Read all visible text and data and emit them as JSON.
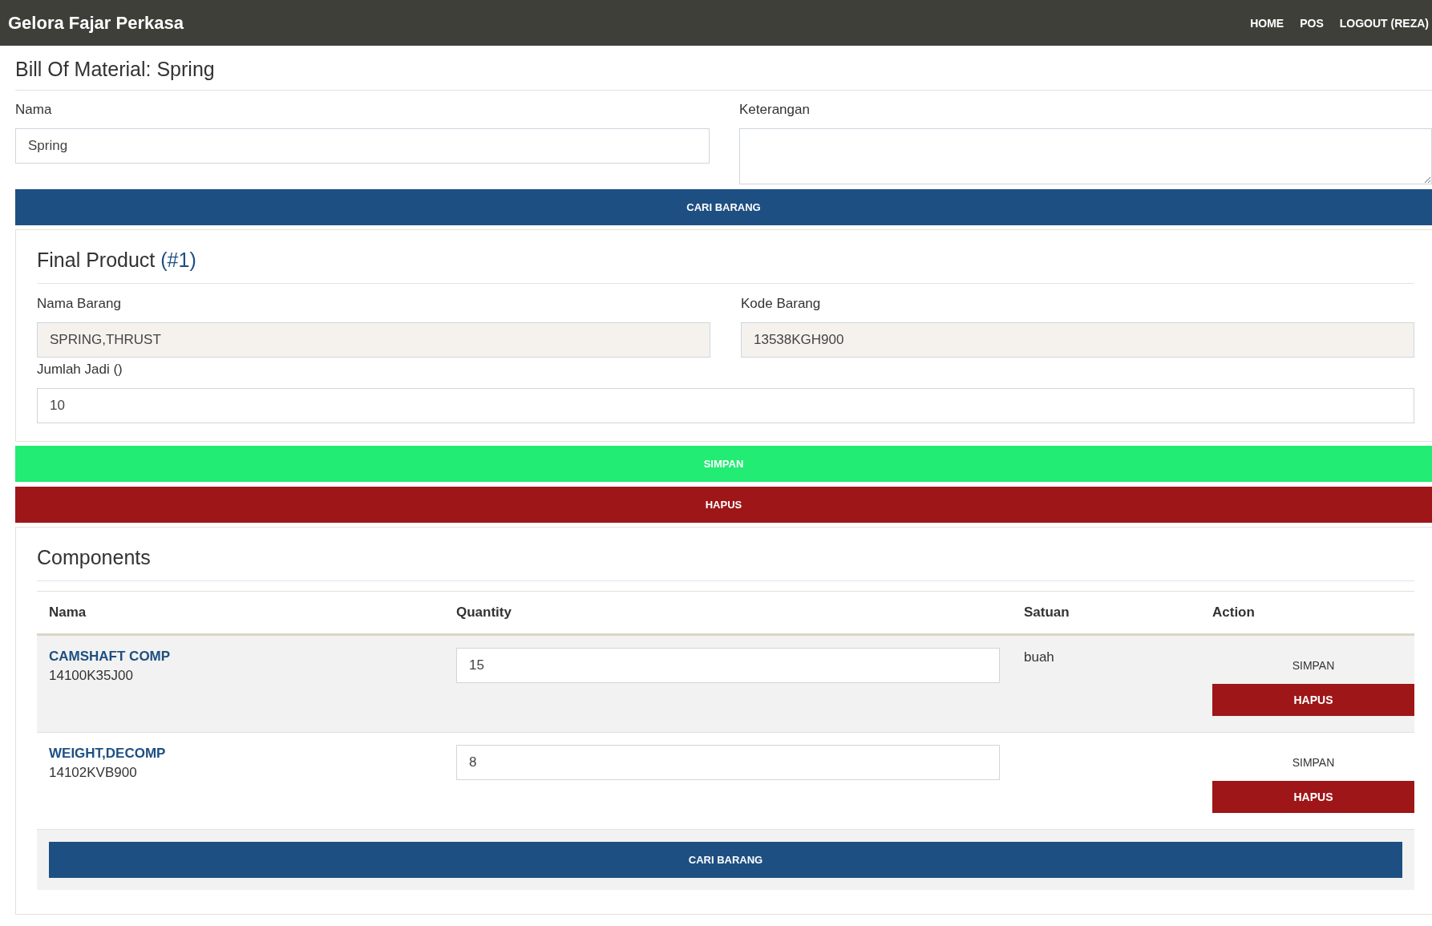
{
  "navbar": {
    "brand": "Gelora Fajar Perkasa",
    "links": [
      "HOME",
      "POS",
      "LOGOUT (REZA)"
    ]
  },
  "page": {
    "title": "Bill Of Material: Spring"
  },
  "form": {
    "fields": [
      {
        "label": "Nama",
        "value": "Spring",
        "kind": "input"
      },
      {
        "label": "Keterangan",
        "kind": "textarea"
      }
    ]
  },
  "search_button": "CARI BARANG",
  "final_product": {
    "title": "Final Product",
    "number": "(#1)",
    "fields": [
      {
        "label": "Nama Barang",
        "value": "SPRING,THRUST",
        "readonly": true
      },
      {
        "label": "Kode Barang",
        "value": "13538KGH900",
        "readonly": true
      },
      {
        "label": "Jumlah Jadi ()",
        "value": "10",
        "readonly": false
      }
    ]
  },
  "save_button": "SIMPAN",
  "delete_button": "HAPUS",
  "components": {
    "title": "Components",
    "columns": [
      "Nama",
      "Quantity",
      "Satuan",
      "Action"
    ],
    "rows": [
      {
        "name": "CAMSHAFT COMP",
        "code": "14100K35J00",
        "quantity": "15",
        "unit": "buah",
        "save": "SIMPAN",
        "delete": "HAPUS"
      },
      {
        "name": "WEIGHT,DECOMP",
        "code": "14102KVB900",
        "quantity": "8",
        "save": "SIMPAN",
        "delete": "HAPUS"
      }
    ],
    "search_button": "CARI BARANG"
  }
}
